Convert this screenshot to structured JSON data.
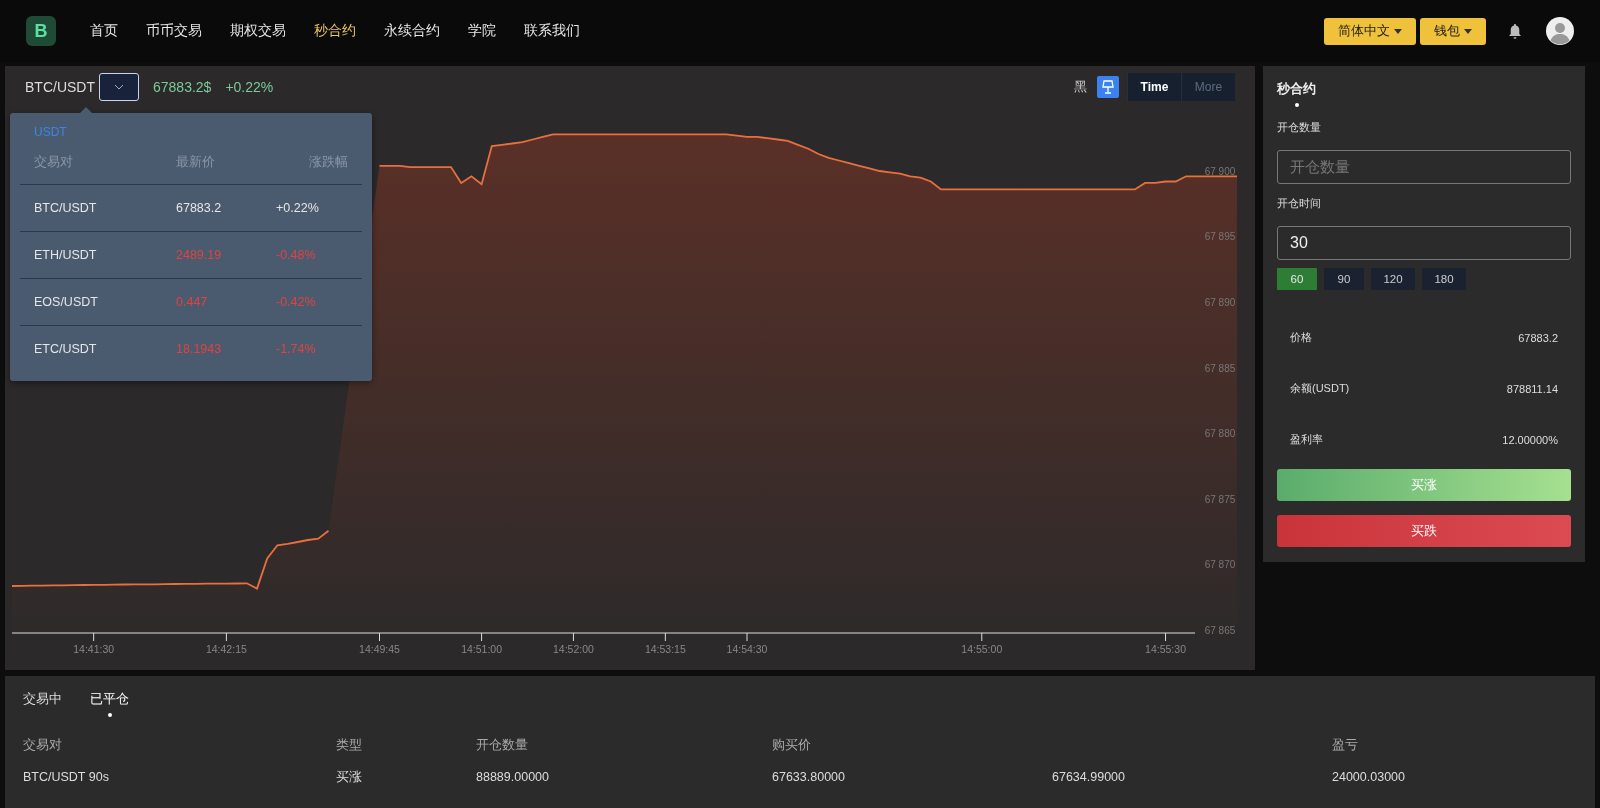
{
  "nav": {
    "logo": "B",
    "items": [
      {
        "label": "首页",
        "selected": false
      },
      {
        "label": "币币交易",
        "selected": false
      },
      {
        "label": "期权交易",
        "selected": false
      },
      {
        "label": "秒合约",
        "selected": true
      },
      {
        "label": "永续合约",
        "selected": false
      },
      {
        "label": "学院",
        "selected": false
      },
      {
        "label": "联系我们",
        "selected": false
      }
    ],
    "language": "简体中文",
    "wallet": "钱包"
  },
  "chart_header": {
    "pair": "BTC/USDT",
    "price": "67883.2$",
    "change": "+0.22%",
    "theme_label": "黑",
    "tabs": [
      {
        "label": "Time",
        "selected": true
      },
      {
        "label": "More",
        "selected": false
      }
    ]
  },
  "pair_dropdown": {
    "market": "USDT",
    "columns": [
      "交易对",
      "最新价",
      "涨跌幅"
    ],
    "rows": [
      {
        "pair": "BTC/USDT",
        "price": "67883.2",
        "change": "+0.22%",
        "color": "#e6e6e6"
      },
      {
        "pair": "ETH/USDT",
        "price": "2489.19",
        "change": "-0.48%",
        "color": "#e0433f"
      },
      {
        "pair": "EOS/USDT",
        "price": "0.447",
        "change": "-0.42%",
        "color": "#e0433f"
      },
      {
        "pair": "ETC/USDT",
        "price": "18.1943",
        "change": "-1.74%",
        "color": "#e0433f"
      }
    ]
  },
  "chart_data": {
    "type": "area",
    "ylim": [
      67862,
      67908
    ],
    "categories": [
      null,
      null,
      null,
      null,
      null,
      null,
      null,
      null,
      "14:41:30",
      null,
      null,
      null,
      null,
      null,
      null,
      null,
      null,
      null,
      null,
      null,
      null,
      "14:42:15",
      null,
      null,
      null,
      null,
      null,
      null,
      null,
      null,
      null,
      null,
      null,
      null,
      null,
      null,
      "14:49:45",
      null,
      null,
      null,
      null,
      null,
      null,
      null,
      null,
      null,
      "14:51:00",
      null,
      null,
      null,
      null,
      null,
      null,
      null,
      null,
      "14:52:00",
      null,
      null,
      null,
      null,
      null,
      null,
      null,
      null,
      "14:53:15",
      null,
      null,
      null,
      null,
      null,
      null,
      null,
      "14:54:30",
      null,
      null,
      null,
      null,
      null,
      null,
      null,
      null,
      null,
      null,
      null,
      null,
      null,
      null,
      null,
      null,
      null,
      null,
      null,
      null,
      null,
      null,
      "14:55:00",
      null,
      null,
      null,
      null,
      null,
      null,
      null,
      null,
      null,
      null,
      null,
      null,
      null,
      null,
      null,
      null,
      null,
      "14:55:30",
      null,
      null,
      null,
      null,
      null,
      null,
      null
    ],
    "series": [
      {
        "color": "#e8703f",
        "values": [
          67868.4,
          67868.41,
          67868.42,
          67868.43,
          67868.44,
          67868.45,
          67868.46,
          67868.47,
          67868.48,
          67868.49,
          67868.5,
          67868.51,
          67868.52,
          67868.52,
          67868.53,
          67868.54,
          67868.55,
          67868.56,
          67868.56,
          67868.57,
          67868.58,
          67868.58,
          67868.59,
          67868.6,
          67868.2,
          67870.5,
          67871.5,
          67871.6,
          67871.75,
          67871.9,
          67872.0,
          67872.6,
          null,
          null,
          null,
          null,
          67900.4,
          67900.4,
          67900.4,
          67900.3,
          67900.3,
          67900.3,
          67900.3,
          67900.3,
          67899.1,
          67899.6,
          67899.0,
          67901.9,
          67902.0,
          67902.1,
          67902.2,
          67902.4,
          67902.6,
          67902.8,
          67902.8,
          67902.8,
          67902.8,
          67902.8,
          67902.8,
          67902.8,
          67902.8,
          67902.8,
          67902.8,
          67902.8,
          67902.8,
          67902.8,
          67902.8,
          67902.8,
          67902.8,
          67902.8,
          67902.8,
          67902.7,
          67902.6,
          67902.6,
          67902.5,
          67902.4,
          67902.3,
          67902.0,
          67901.7,
          67901.3,
          67901.0,
          67900.8,
          67900.6,
          67900.4,
          67900.2,
          67900.0,
          67899.9,
          67899.8,
          67899.6,
          67899.5,
          67899.2,
          67898.6,
          67898.6,
          67898.6,
          67898.6,
          67898.6,
          67898.6,
          67898.6,
          67898.6,
          67898.6,
          67898.6,
          67898.6,
          67898.6,
          67898.6,
          67898.6,
          67898.6,
          67898.6,
          67898.6,
          67898.6,
          67898.6,
          67898.6,
          67899.1,
          67899.1,
          67899.2,
          67899.2,
          67899.6,
          67899.6,
          67899.6,
          67899.6,
          67899.6,
          67899.6
        ]
      }
    ],
    "yticks": [
      {
        "value": 67865,
        "label": "67 865"
      },
      {
        "value": 67870,
        "label": "67 870"
      },
      {
        "value": 67875,
        "label": "67 875"
      },
      {
        "value": 67880,
        "label": "67 880"
      },
      {
        "value": 67885,
        "label": "67 885"
      },
      {
        "value": 67890,
        "label": "67 890"
      },
      {
        "value": 67895,
        "label": "67 895"
      },
      {
        "value": 67900,
        "label": "67 900"
      }
    ],
    "orientation": "vertical"
  },
  "order_panel": {
    "tabs": [
      {
        "label": "秒合约",
        "selected": true
      }
    ],
    "quantity_label": "开仓数量",
    "quantity_placeholder": "开仓数量",
    "time_label": "开仓时间",
    "time_value": "30",
    "durations": [
      {
        "label": "60",
        "selected": true
      },
      {
        "label": "90",
        "selected": false
      },
      {
        "label": "120",
        "selected": false
      },
      {
        "label": "180",
        "selected": false
      }
    ],
    "info": [
      {
        "label": "价格",
        "value": "67883.2"
      },
      {
        "label": "余额(USDT)",
        "value": "878811.14"
      },
      {
        "label": "盈利率",
        "value": "12.00000%"
      }
    ],
    "buy_up": "买涨",
    "buy_down": "买跌"
  },
  "orders": {
    "tabs": [
      {
        "label": "交易中",
        "selected": false
      },
      {
        "label": "已平仓",
        "selected": true
      }
    ],
    "columns": [
      "交易对",
      "类型",
      "开仓数量",
      "购买价",
      "",
      "盈亏"
    ],
    "rows": [
      [
        "BTC/USDT 90s",
        "买涨",
        "88889.00000",
        "67633.80000",
        "67634.99000",
        "24000.03000"
      ]
    ]
  }
}
